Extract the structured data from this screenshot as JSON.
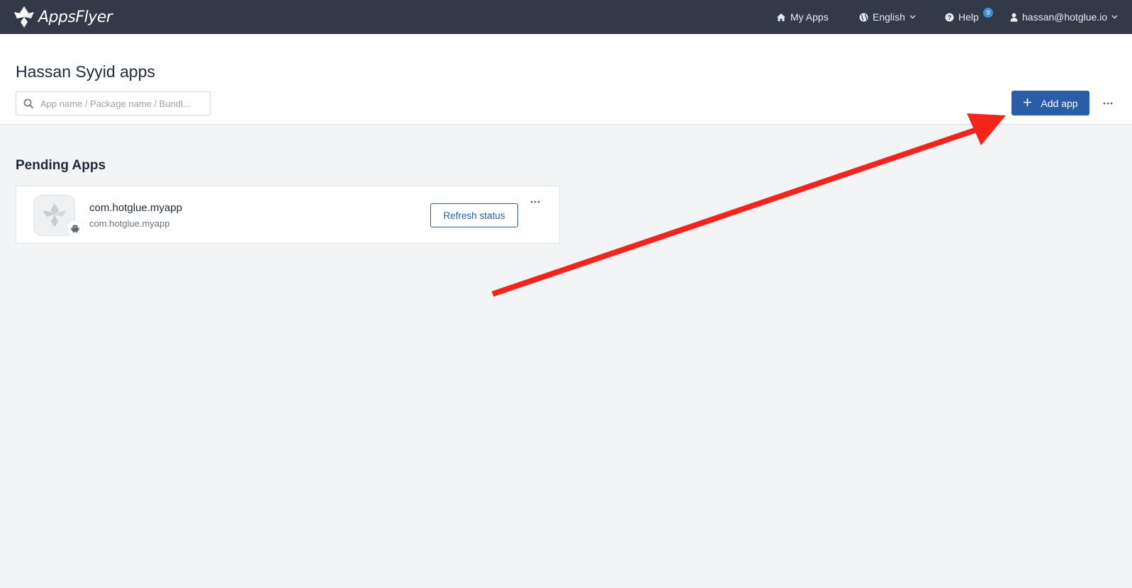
{
  "nav": {
    "brand": "AppsFlyer",
    "my_apps": "My Apps",
    "language": "English",
    "help": "Help",
    "help_badge": "9",
    "user": "hassan@hotglue.io",
    "icons": [
      "home-icon",
      "globe-icon",
      "question-circle-icon",
      "user-icon",
      "chevron-down-icon"
    ]
  },
  "header": {
    "title": "Hassan Syyid apps",
    "search_placeholder": "App name / Package name / Bundl...",
    "add_app": "Add app"
  },
  "pending": {
    "title": "Pending Apps",
    "apps": [
      {
        "name": "com.hotglue.myapp",
        "package": "com.hotglue.myapp",
        "platform": "android-icon",
        "action": "Refresh status"
      }
    ]
  },
  "colors": {
    "nav_bg": "#313a46",
    "primary": "#2a5ca8",
    "page_bg": "#f3f4f6",
    "annotation": "#f2241c"
  }
}
